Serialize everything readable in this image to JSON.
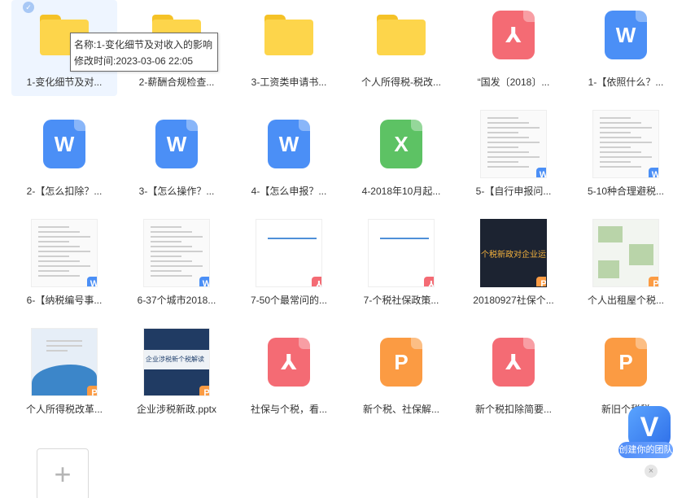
{
  "tooltip": {
    "name_line": "名称:1-变化细节及对收入的影响",
    "time_line": "修改时间:2023-03-06 22:05"
  },
  "files": [
    {
      "name": "1-变化细节及对...",
      "kind": "folder",
      "icon": "folder-icon",
      "selected": true
    },
    {
      "name": "2-薪酬合规检查...",
      "kind": "folder",
      "icon": "folder-icon"
    },
    {
      "name": "3-工资类申请书...",
      "kind": "folder",
      "icon": "folder-icon"
    },
    {
      "name": "个人所得税-税改...",
      "kind": "folder",
      "icon": "folder-icon"
    },
    {
      "name": "“国发〔2018〕...",
      "kind": "pdf",
      "icon": "pdf-icon"
    },
    {
      "name": "1-【依照什么？...",
      "kind": "word",
      "icon": "word-icon"
    },
    {
      "name": "2-【怎么扣除？...",
      "kind": "word",
      "icon": "word-icon"
    },
    {
      "name": "3-【怎么操作？...",
      "kind": "word",
      "icon": "word-icon"
    },
    {
      "name": "4-【怎么申报？...",
      "kind": "word",
      "icon": "word-icon"
    },
    {
      "name": "4-2018年10月起...",
      "kind": "excel",
      "icon": "excel-icon"
    },
    {
      "name": "5-【自行申报问...",
      "kind": "thumb-doc",
      "badge": "word"
    },
    {
      "name": "5-10种合理避税...",
      "kind": "thumb-doc",
      "badge": "word"
    },
    {
      "name": "6-【纳税编号事...",
      "kind": "thumb-doc",
      "badge": "word"
    },
    {
      "name": "6-37个城市2018...",
      "kind": "thumb-doc",
      "badge": "word"
    },
    {
      "name": "7-50个最常问的...",
      "kind": "thumb-ppt",
      "badge": "pdf"
    },
    {
      "name": "7-个税社保政策...",
      "kind": "thumb-ppt",
      "badge": "pdf"
    },
    {
      "name": "20180927社保个...",
      "kind": "thumb-dark",
      "badge": "ppt",
      "thumb_text": "个税新政对企业运营的"
    },
    {
      "name": "个人出租屋个税...",
      "kind": "thumb-leaflet",
      "badge": "ppt"
    },
    {
      "name": "个人所得税改革...",
      "kind": "thumb-blue",
      "badge": "ppt"
    },
    {
      "name": "企业涉税新政.pptx",
      "kind": "thumb-navy",
      "badge": "ppt",
      "thumb_text": "企业涉税新个税解读"
    },
    {
      "name": "社保与个税，看...",
      "kind": "pdf",
      "icon": "pdf-icon"
    },
    {
      "name": "新个税、社保解...",
      "kind": "ppt",
      "icon": "ppt-icon"
    },
    {
      "name": "新个税扣除简要...",
      "kind": "pdf",
      "icon": "pdf-icon"
    },
    {
      "name": "新旧个税税",
      "kind": "ppt",
      "icon": "ppt-icon"
    }
  ],
  "add_tile": {
    "label": "+"
  },
  "promo": {
    "logo": "V",
    "text": "创建你的团队",
    "close": "×"
  },
  "colors": {
    "pdf": "#f46b74",
    "word": "#4b8ff6",
    "excel": "#5dc264",
    "ppt": "#fb9b43",
    "folder": "#fdd54b",
    "selected_bg": "#eef5ff"
  }
}
